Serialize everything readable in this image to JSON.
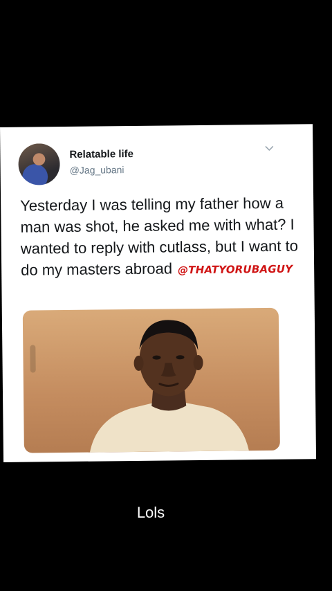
{
  "tweet": {
    "display_name": "Relatable life",
    "handle": "@Jag_ubani",
    "text": "Yesterday I was telling my father how a man was shot, he asked me with what?  I wanted to reply with cutlass, but I want to do my masters abroad",
    "watermark": "@THATYORUBAGUY"
  },
  "caption": "Lols",
  "icons": {
    "chevron": "chevron-down-icon"
  },
  "colors": {
    "background": "#000000",
    "card": "#ffffff",
    "handle_gray": "#657786",
    "watermark_red": "#d01515"
  }
}
